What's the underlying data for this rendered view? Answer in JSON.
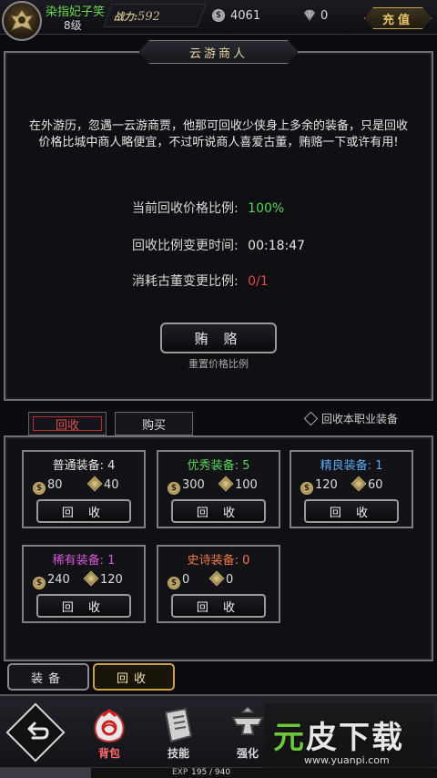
{
  "player": {
    "name": "染指妃子笑",
    "level": "8级",
    "power_label": "战力:",
    "power_value": "592"
  },
  "currency": {
    "silver": "4061",
    "gems": "0",
    "recharge_label": "充值"
  },
  "merchant": {
    "title": "云游商人",
    "description": "在外游历，忽遇一云游商贾，他那可回收少侠身上多余的装备，只是回收价格比城中商人略便宜，不过听说商人喜爱古董，贿赂一下或许有用!",
    "rows": [
      {
        "label": "当前回收价格比例:",
        "value": "100%",
        "color": "#5ad65a"
      },
      {
        "label": "回收比例变更时间:",
        "value": "00:18:47",
        "color": "#e6e6e6"
      },
      {
        "label": "消耗古董变更比例:",
        "value": "0/1",
        "color": "#e04848"
      }
    ],
    "bribe_label": "贿 赂",
    "bribe_sub": "重置价格比例"
  },
  "tabs": {
    "recycle": "回收",
    "buy": "购买"
  },
  "only_class_label": "回收本职业装备",
  "cards": [
    {
      "title": "普通装备: 4",
      "color": "#e6e6e6",
      "coins": "80",
      "diamonds": "40",
      "button": "回 收"
    },
    {
      "title": "优秀装备: 5",
      "color": "#5ad65a",
      "coins": "300",
      "diamonds": "100",
      "button": "回 收"
    },
    {
      "title": "精良装备: 1",
      "color": "#5aa9f0",
      "coins": "120",
      "diamonds": "60",
      "button": "回 收"
    },
    {
      "title": "稀有装备: 1",
      "color": "#d35ad8",
      "coins": "240",
      "diamonds": "120",
      "button": "回 收"
    },
    {
      "title": "史诗装备: 0",
      "color": "#f07a4a",
      "coins": "0",
      "diamonds": "0",
      "button": "回 收"
    }
  ],
  "modes": {
    "equip": "装备",
    "recycle": "回收"
  },
  "nav": {
    "bag": "背包",
    "skill": "技能",
    "strengthen": "强化"
  },
  "exp": {
    "label": "EXP",
    "value": "195 / 940",
    "current": 195,
    "max": 940
  },
  "watermark": {
    "text_a": "元",
    "text_b": "皮下载",
    "url": "www.yuanpi.com"
  },
  "colors": {
    "accent_gold": "#c9a24a",
    "recycle_red": "#e05050"
  }
}
